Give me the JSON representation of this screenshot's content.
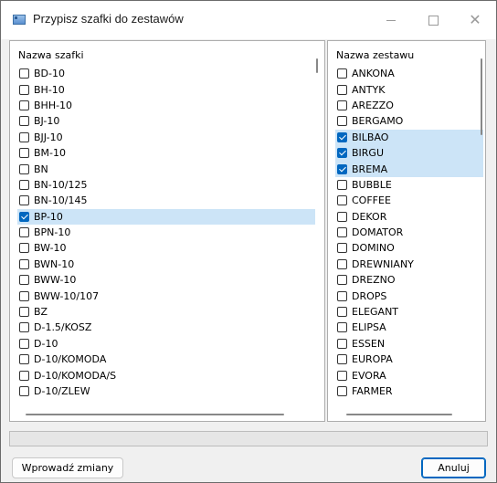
{
  "window": {
    "title": "Przypisz szafki do zestawów",
    "controls": {
      "minimize": "—",
      "maximize": "☐",
      "close": "✕"
    }
  },
  "left_panel": {
    "header": "Nazwa szafki",
    "items": [
      {
        "label": "BD-10",
        "checked": false
      },
      {
        "label": "BH-10",
        "checked": false
      },
      {
        "label": "BHH-10",
        "checked": false
      },
      {
        "label": "BJ-10",
        "checked": false
      },
      {
        "label": "BJJ-10",
        "checked": false
      },
      {
        "label": "BM-10",
        "checked": false
      },
      {
        "label": "BN",
        "checked": false
      },
      {
        "label": "BN-10/125",
        "checked": false
      },
      {
        "label": "BN-10/145",
        "checked": false
      },
      {
        "label": "BP-10",
        "checked": true
      },
      {
        "label": "BPN-10",
        "checked": false
      },
      {
        "label": "BW-10",
        "checked": false
      },
      {
        "label": "BWN-10",
        "checked": false
      },
      {
        "label": "BWW-10",
        "checked": false
      },
      {
        "label": "BWW-10/107",
        "checked": false
      },
      {
        "label": "BZ",
        "checked": false
      },
      {
        "label": "D-1.5/KOSZ",
        "checked": false
      },
      {
        "label": "D-10",
        "checked": false
      },
      {
        "label": "D-10/KOMODA",
        "checked": false
      },
      {
        "label": "D-10/KOMODA/S",
        "checked": false
      },
      {
        "label": "D-10/ZLEW",
        "checked": false
      }
    ]
  },
  "right_panel": {
    "header": "Nazwa zestawu",
    "items": [
      {
        "label": "ANKONA",
        "checked": false
      },
      {
        "label": "ANTYK",
        "checked": false
      },
      {
        "label": "AREZZO",
        "checked": false
      },
      {
        "label": "BERGAMO",
        "checked": false
      },
      {
        "label": "BILBAO",
        "checked": true
      },
      {
        "label": "BIRGU",
        "checked": true
      },
      {
        "label": "BREMA",
        "checked": true
      },
      {
        "label": "BUBBLE",
        "checked": false
      },
      {
        "label": "COFFEE",
        "checked": false
      },
      {
        "label": "DEKOR",
        "checked": false
      },
      {
        "label": "DOMATOR",
        "checked": false
      },
      {
        "label": "DOMINO",
        "checked": false
      },
      {
        "label": "DREWNIANY",
        "checked": false
      },
      {
        "label": "DREZNO",
        "checked": false
      },
      {
        "label": "DROPS",
        "checked": false
      },
      {
        "label": "ELEGANT",
        "checked": false
      },
      {
        "label": "ELIPSA",
        "checked": false
      },
      {
        "label": "ESSEN",
        "checked": false
      },
      {
        "label": "EUROPA",
        "checked": false
      },
      {
        "label": "EVORA",
        "checked": false
      },
      {
        "label": "FARMER",
        "checked": false
      }
    ]
  },
  "buttons": {
    "apply": "Wprowadź zmiany",
    "cancel": "Anuluj"
  },
  "colors": {
    "selection": "#cce4f7",
    "accent": "#0067c0"
  }
}
